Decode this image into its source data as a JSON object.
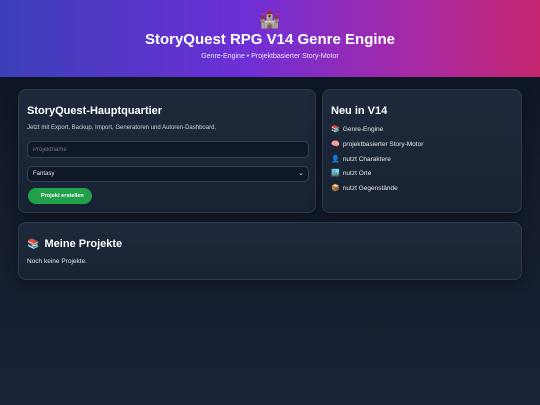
{
  "header": {
    "icon": "castle-icon",
    "icon_glyph": "🏰",
    "title": "StoryQuest RPG V14 Genre Engine",
    "subtitle": "Genre-Engine • Projektbasierter Story-Motor"
  },
  "hq": {
    "title": "StoryQuest-Hauptquartier",
    "description": "Jetzt mit Export, Backup, Import, Generatoren und Autoren-Dashboard.",
    "project_name_placeholder": "Projektname",
    "genre_selected": "Fantasy",
    "create_button": "Projekt erstellen"
  },
  "news": {
    "title": "Neu in V14",
    "items": [
      {
        "icon": "books-icon",
        "glyph": "📚",
        "label": "Genre-Engine"
      },
      {
        "icon": "brain-icon",
        "glyph": "🧠",
        "label": "projektbasierter Story-Motor"
      },
      {
        "icon": "person-icon",
        "glyph": "👤",
        "label": "nutzt Charaktere"
      },
      {
        "icon": "city-icon",
        "glyph": "🏙️",
        "label": "nutzt Orte"
      },
      {
        "icon": "package-icon",
        "glyph": "📦",
        "label": "nutzt Gegenstände"
      }
    ]
  },
  "projects": {
    "icon_glyph": "📚",
    "title": "Meine Projekte",
    "empty_text": "Noch keine Projekte."
  }
}
